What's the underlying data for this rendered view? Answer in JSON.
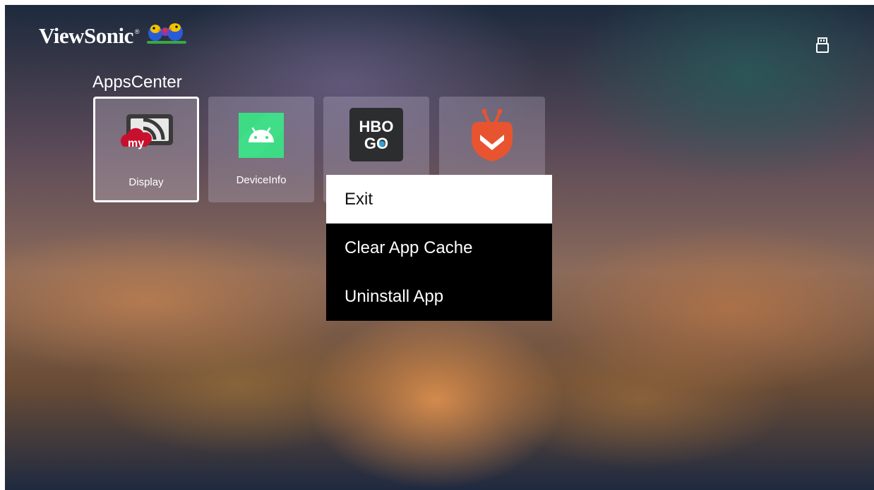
{
  "header": {
    "brand": "ViewSonic",
    "brand_mark": "®"
  },
  "section": {
    "title": "AppsCenter"
  },
  "apps": [
    {
      "label": "Display",
      "icon": "display-cast-icon",
      "focused": true
    },
    {
      "label": "DeviceInfo",
      "icon": "android-icon"
    },
    {
      "label": "",
      "icon": "hbo-go-icon"
    },
    {
      "label": "",
      "icon": "aptoide-tv-icon"
    }
  ],
  "context_menu": {
    "items": [
      {
        "label": "Exit",
        "selected": true
      },
      {
        "label": "Clear App Cache"
      },
      {
        "label": "Uninstall App"
      }
    ]
  },
  "icon_labels": {
    "my": "my",
    "hbo": "HBO",
    "go": "GO"
  },
  "colors": {
    "focus_border": "#ffffff",
    "menu_background": "#000000",
    "menu_selected_background": "#ffffff",
    "android_green": "#3ddc84",
    "cast_red": "#c8102e",
    "aptoide_orange": "#e8542f"
  }
}
